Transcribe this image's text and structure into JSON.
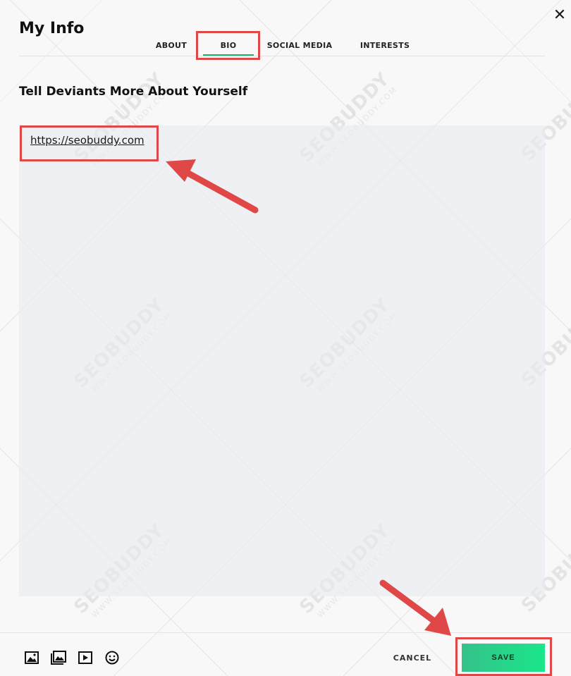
{
  "modal": {
    "title": "My Info",
    "close_glyph": "✕"
  },
  "tabs": [
    {
      "label": "ABOUT",
      "active": false
    },
    {
      "label": "BIO",
      "active": true
    },
    {
      "label": "SOCIAL MEDIA",
      "active": false
    },
    {
      "label": "INTERESTS",
      "active": false
    }
  ],
  "bio": {
    "heading": "Tell Deviants More About Yourself",
    "content_link": "https://seobuddy.com"
  },
  "toolbar": {
    "icons": [
      "image-icon",
      "gallery-icon",
      "video-icon",
      "emoji-icon"
    ]
  },
  "footer": {
    "cancel_label": "CANCEL",
    "save_label": "SAVE"
  },
  "watermark": {
    "text": "SEOBUDDY",
    "subtext": "WWW.SEOBUDDY.COM"
  },
  "colors": {
    "accent": "#1bb46f",
    "save_button": "#1ae68a",
    "annotation": "#e04848"
  }
}
